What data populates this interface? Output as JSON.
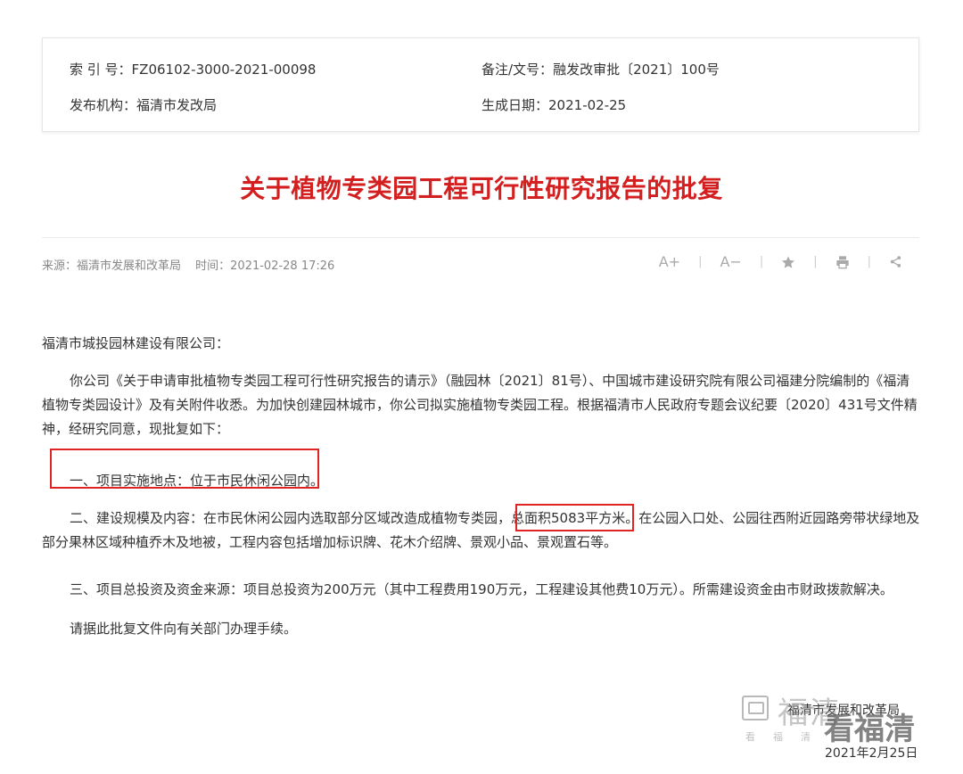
{
  "meta": {
    "index_label": "索 引 号：",
    "index_value": "FZ06102-3000-2021-00098",
    "doc_label": "备注/文号：",
    "doc_value": "融发改审批〔2021〕100号",
    "org_label": "发布机构：",
    "org_value": "福清市发改局",
    "date_label": "生成日期：",
    "date_value": "2021-02-25"
  },
  "article": {
    "title": "关于植物专类园工程可行性研究报告的批复",
    "source": "来源：福清市发展和改革局",
    "time": "时间：2021-02-28 17:26"
  },
  "tools": {
    "font_increase": "A+",
    "font_decrease": "A−"
  },
  "body": {
    "salutation": "福清市城投园林建设有限公司：",
    "para1": "你公司《关于申请审批植物专类园工程可行性研究报告的请示》（融园林〔2021〕81号）、中国城市建设研究院有限公司福建分院编制的《福清植物专类园设计》及有关附件收悉。为加快创建园林城市，你公司拟实施植物专类园工程。根据福清市人民政府专题会议纪要〔2020〕431号文件精神，经研究同意，现批复如下：",
    "item1": "一、项目实施地点：位于市民休闲公园内。",
    "item2_a": "二、建设规模及内容：在市民休闲公园内选取部分区域改造成植物专类园，",
    "item2_hl": "总面积5083平方米",
    "item2_b": "。在公园入口处、公园往西附近园路旁带状绿地及部分果林区域种植乔木及地被，工程内容包括增加标识牌、花木介绍牌、景观小品、景观置石等。",
    "item3": "三、项目总投资及资金来源：项目总投资为200万元（其中工程费用190万元，工程建设其他费10万元）。所需建设资金由市财政拨款解决。",
    "closing": "请据此批复文件向有关部门办理手续。"
  },
  "footer": {
    "org": "福清市发展和改革局",
    "date": "2021年2月25日"
  },
  "watermark": {
    "line1": "福清",
    "line2": "看福清",
    "small": "看福清"
  },
  "colors": {
    "title": "#d31f1f",
    "highlight_border": "#e02424"
  }
}
